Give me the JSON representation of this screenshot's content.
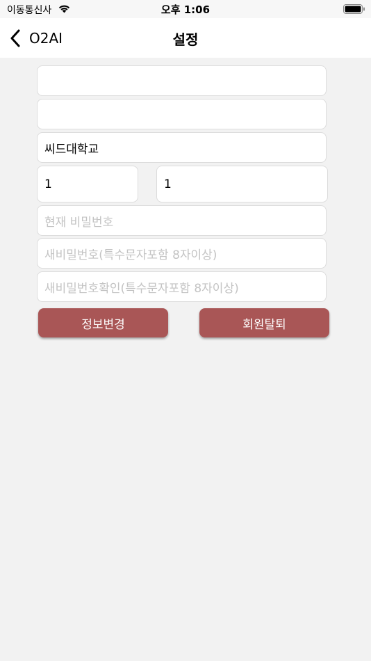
{
  "status_bar": {
    "carrier": "이동통신사",
    "time": "오후 1:06",
    "wifi_icon": "wifi-icon",
    "battery_icon": "battery-icon"
  },
  "nav": {
    "back_label": "O2AI",
    "title": "설정",
    "back_icon": "chevron-left-icon"
  },
  "form": {
    "field1_value": "",
    "field2_value": "",
    "school_value": "씨드대학교",
    "grade_value": "1",
    "class_value": "1",
    "current_password_placeholder": "현재 비밀번호",
    "new_password_placeholder": "새비밀번호(특수문자포함 8자이상)",
    "confirm_password_placeholder": "새비밀번호확인(특수문자포함 8자이상)"
  },
  "buttons": {
    "update_label": "정보변경",
    "withdraw_label": "회원탈퇴",
    "color": "#a95656"
  }
}
